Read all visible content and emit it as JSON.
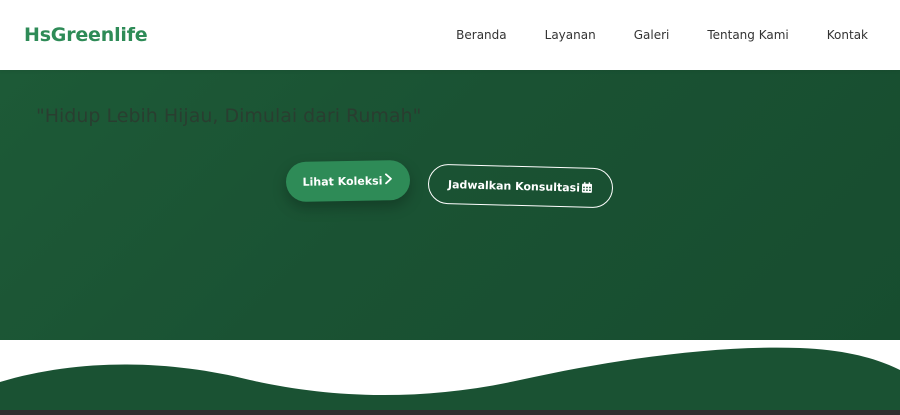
{
  "brand": {
    "name": "HsGreenlife"
  },
  "nav": {
    "items": [
      {
        "label": "Beranda"
      },
      {
        "label": "Layanan"
      },
      {
        "label": "Galeri"
      },
      {
        "label": "Tentang Kami"
      },
      {
        "label": "Kontak"
      }
    ]
  },
  "hero": {
    "tagline": "\"Hidup Lebih Hijau, Dimulai dari Rumah\"",
    "primary_button": {
      "label": "Lihat Koleksi",
      "icon": "chevron-right-icon"
    },
    "secondary_button": {
      "label": "Jadwalkan Konsultasi",
      "icon": "calendar-icon"
    }
  },
  "colors": {
    "brand_green": "#2e8b57",
    "hero_bg": "#1a5233",
    "wave_green": "#1a5233"
  }
}
